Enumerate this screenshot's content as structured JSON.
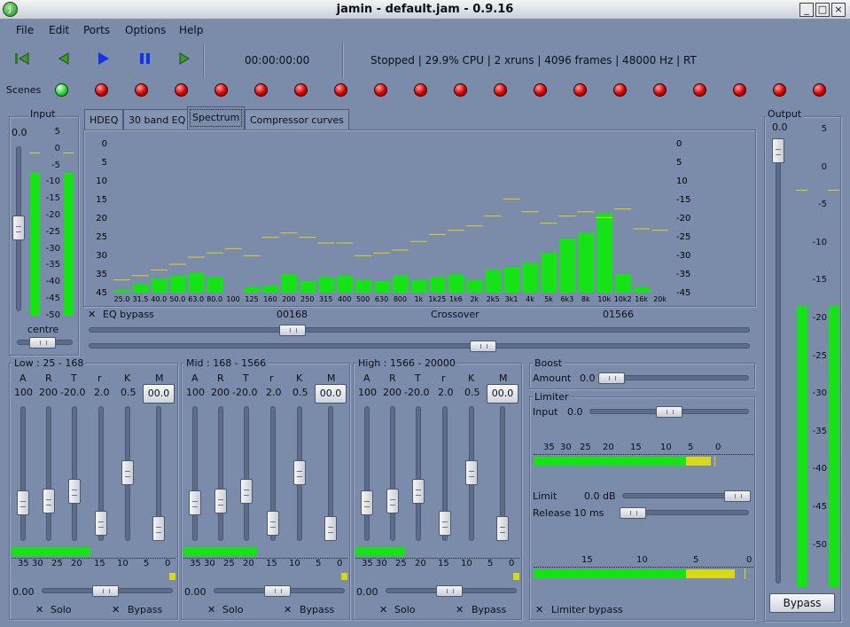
{
  "window": {
    "title": "jamin - default.jam - 0.9.16",
    "app_icon": "J",
    "buttons": [
      "_",
      "□",
      "×"
    ]
  },
  "menu": [
    {
      "label": "File"
    },
    {
      "label": "Edit"
    },
    {
      "label": "Ports"
    },
    {
      "label": "Options"
    },
    {
      "label": "Help"
    }
  ],
  "toolbar": {
    "time": "00:00:00:00",
    "status": "Stopped | 29.9% CPU | 2 xruns | 4096 frames | 48000 Hz | RT"
  },
  "scenes": {
    "label": "Scenes",
    "count": 20,
    "active_index": 0
  },
  "input": {
    "label": "Input",
    "gain": "0.0",
    "pan_label": "centre",
    "scale": [
      "5",
      "0",
      "-5",
      "-10",
      "-15",
      "-20",
      "-25",
      "-30",
      "-35",
      "-40",
      "-45",
      "-50"
    ],
    "meter_level": 0.78
  },
  "output": {
    "label": "Output",
    "gain": "0.0",
    "bypass_label": "Bypass",
    "scale": [
      "5",
      "0",
      "5",
      "10",
      "15",
      "20",
      "25",
      "30",
      "35",
      "40",
      "45",
      "50"
    ],
    "scale_display": [
      "5",
      "0",
      "-5",
      "-10",
      "-15",
      "-20",
      "-25",
      "-30",
      "-35",
      "-40",
      "-45",
      "-50"
    ],
    "meter_level": 0.78
  },
  "tabs": [
    {
      "label": "HDEQ"
    },
    {
      "label": "30 band EQ"
    },
    {
      "label": "Spectrum",
      "active": true
    },
    {
      "label": "Compressor curves"
    }
  ],
  "spectrum": {
    "left_scale": [
      "0",
      "5",
      "10",
      "15",
      "20",
      "25",
      "30",
      "35",
      "45"
    ],
    "right_scale": [
      "0",
      "5",
      "10",
      "-15",
      "-20",
      "-25",
      "-30",
      "-35",
      "-45"
    ],
    "bands": [
      "25.0",
      "31.5",
      "40.0",
      "50.0",
      "63.0",
      "80.0",
      "100",
      "125",
      "160",
      "200",
      "250",
      "315",
      "400",
      "500",
      "630",
      "800",
      "1k",
      "1k25",
      "1k6",
      "2k",
      "2k5",
      "3k1",
      "4k",
      "5k",
      "6k3",
      "8k",
      "10k",
      "10k2",
      "16k",
      "20k"
    ],
    "levels": [
      0.02,
      0.06,
      0.1,
      0.12,
      0.14,
      0.11,
      0.0,
      0.04,
      0.05,
      0.13,
      0.08,
      0.11,
      0.12,
      0.09,
      0.08,
      0.12,
      0.09,
      0.11,
      0.13,
      0.09,
      0.16,
      0.18,
      0.21,
      0.28,
      0.38,
      0.42,
      0.56,
      0.13,
      0.04,
      0.0
    ],
    "peaks": [
      0.09,
      0.12,
      0.16,
      0.2,
      0.25,
      0.28,
      0.31,
      0.26,
      0.39,
      0.42,
      0.39,
      0.35,
      0.35,
      0.26,
      0.28,
      0.3,
      0.36,
      0.41,
      0.44,
      0.47,
      0.54,
      0.66,
      0.57,
      0.49,
      0.54,
      0.57,
      0.53,
      0.59,
      0.45,
      0.44
    ]
  },
  "crossover": {
    "eq_bypass_label": "EQ bypass",
    "low_value": "00168",
    "label": "Crossover",
    "high_value": "01566",
    "low_pos": 0.3,
    "high_pos": 0.6
  },
  "bands_comp": [
    {
      "label": "Low : 25 - 168",
      "headers": [
        "A",
        "R",
        "T",
        "r",
        "K",
        "M"
      ],
      "values": [
        "100",
        "200",
        "-20.0",
        "2.0",
        "0.5"
      ],
      "makeup": "00.0",
      "scale": [
        "35",
        "30",
        "25",
        "20",
        "15",
        "10",
        "5",
        "0"
      ],
      "gain": "0.00",
      "solo": "Solo",
      "bypass": "Bypass",
      "meter": 0.48
    },
    {
      "label": "Mid : 168 - 1566",
      "headers": [
        "A",
        "R",
        "T",
        "r",
        "K",
        "M"
      ],
      "values": [
        "100",
        "200",
        "-20.0",
        "2.0",
        "0.5"
      ],
      "makeup": "00.0",
      "scale": [
        "35",
        "30",
        "25",
        "20",
        "15",
        "10",
        "5",
        "0"
      ],
      "gain": "0.00",
      "solo": "Solo",
      "bypass": "Bypass",
      "meter": 0.45
    },
    {
      "label": "High : 1566 - 20000",
      "headers": [
        "A",
        "R",
        "T",
        "r",
        "K",
        "M"
      ],
      "values": [
        "100",
        "200",
        "-20.0",
        "2.0",
        "0.5"
      ],
      "makeup": "00.0",
      "scale": [
        "35",
        "30",
        "25",
        "20",
        "15",
        "10",
        "5",
        "0"
      ],
      "gain": "0.00",
      "solo": "Solo",
      "bypass": "Bypass",
      "meter": 0.3
    }
  ],
  "boost": {
    "label": "Boost",
    "amount_label": "Amount",
    "amount": "0.0"
  },
  "limiter": {
    "label": "Limiter",
    "input_label": "Input",
    "input": "0.0",
    "scale": [
      "35",
      "30",
      "25",
      "20",
      "15",
      "10",
      "5",
      "0"
    ],
    "limit_label": "Limit",
    "limit": "0.0 dB",
    "release_label": "Release 10 ms",
    "scale2": [
      "15",
      "10",
      "5",
      "0"
    ],
    "bypass_label": "Limiter bypass"
  }
}
